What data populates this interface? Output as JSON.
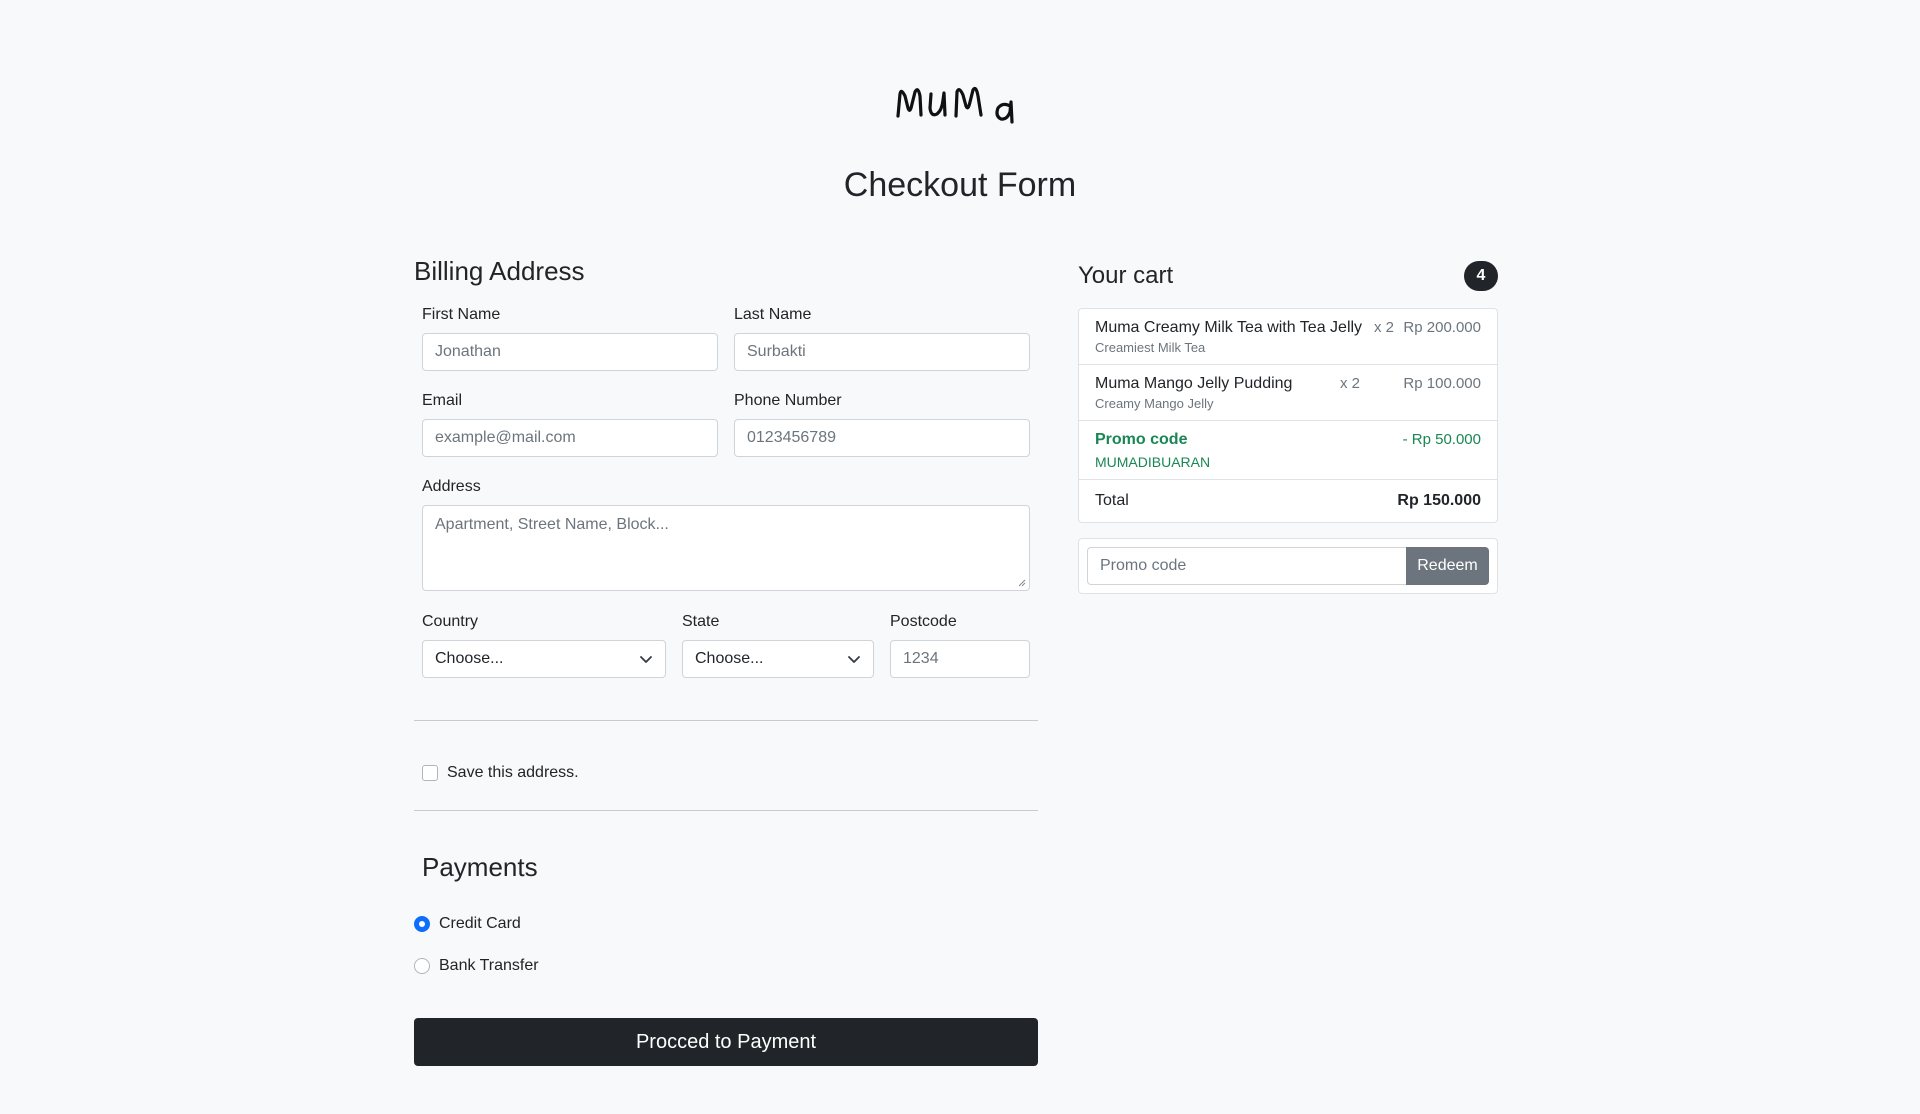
{
  "brand": {
    "logo_text": "muma"
  },
  "page": {
    "title": "Checkout Form"
  },
  "billing": {
    "title": "Billing Address",
    "first_name": {
      "label": "First Name",
      "placeholder": "Jonathan"
    },
    "last_name": {
      "label": "Last Name",
      "placeholder": "Surbakti"
    },
    "email": {
      "label": "Email",
      "placeholder": "example@mail.com"
    },
    "phone": {
      "label": "Phone Number",
      "placeholder": "0123456789"
    },
    "address": {
      "label": "Address",
      "placeholder": "Apartment, Street Name, Block..."
    },
    "country": {
      "label": "Country",
      "value": "Choose..."
    },
    "state": {
      "label": "State",
      "value": "Choose..."
    },
    "postcode": {
      "label": "Postcode",
      "placeholder": "1234"
    },
    "save_address_label": "Save this address."
  },
  "payments": {
    "title": "Payments",
    "options": [
      {
        "label": "Credit Card",
        "checked": true
      },
      {
        "label": "Bank Transfer",
        "checked": false
      }
    ],
    "submit_label": "Procced to Payment"
  },
  "cart": {
    "title": "Your cart",
    "count": "4",
    "items": [
      {
        "name": "Muma Creamy Milk Tea with Tea Jelly",
        "description": "Creamiest Milk Tea",
        "qty": "x 2",
        "price": "Rp 200.000"
      },
      {
        "name": "Muma Mango Jelly Pudding",
        "description": "Creamy Mango Jelly",
        "qty": "x 2",
        "price": "Rp 100.000"
      }
    ],
    "promo": {
      "label": "Promo code",
      "code": "MUMADIBUARAN",
      "amount": "- Rp 50.000"
    },
    "total": {
      "label": "Total",
      "value": "Rp 150.000"
    },
    "promo_input": {
      "placeholder": "Promo code",
      "button_label": "Redeem"
    }
  },
  "colors": {
    "background": "#f8f9fa",
    "dark": "#212529",
    "muted": "#6c757d",
    "success": "#198754",
    "primary": "#0d6efd"
  }
}
